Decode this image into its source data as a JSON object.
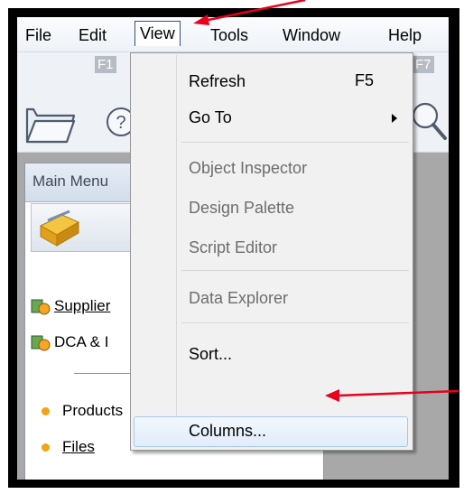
{
  "menubar": {
    "items": [
      "File",
      "Edit",
      "View",
      "Tools",
      "Window",
      "Help"
    ],
    "active": "View"
  },
  "toolbar": {
    "fkey_left": "F1",
    "fkey_right": "F7",
    "icons": [
      "folder-icon",
      "help-icon",
      "magnifier-icon"
    ]
  },
  "main_menu": {
    "title": "Main Menu",
    "links": [
      "Supplier",
      "DCA & I"
    ],
    "bullets": [
      "Products",
      "Files"
    ]
  },
  "view_menu": {
    "refresh": "Refresh",
    "refresh_shortcut": "F5",
    "goto": "Go To",
    "object_inspector": "Object Inspector",
    "design_palette": "Design Palette",
    "script_editor": "Script Editor",
    "data_explorer": "Data Explorer",
    "sort": "Sort...",
    "columns": "Columns..."
  },
  "colors": {
    "annotation_arrow": "#e8001c",
    "bullet": "#f2a316",
    "hover": "#e1edfa"
  }
}
